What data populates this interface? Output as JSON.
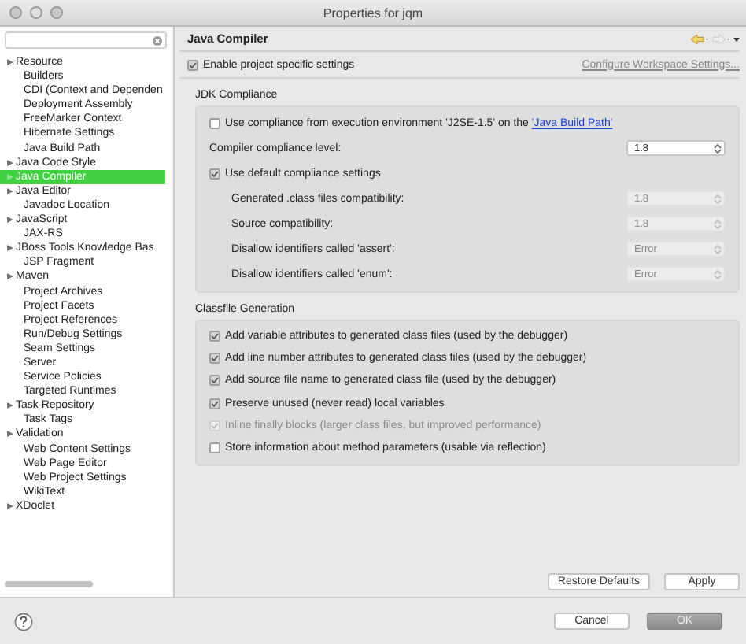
{
  "window": {
    "title": "Properties for jqm"
  },
  "sidebar": {
    "items": [
      {
        "label": "Resource",
        "kind": "group",
        "selected": false
      },
      {
        "label": "Builders",
        "kind": "page",
        "selected": false
      },
      {
        "label": "CDI (Context and Dependen",
        "kind": "page",
        "selected": false
      },
      {
        "label": "Deployment Assembly",
        "kind": "page",
        "selected": false
      },
      {
        "label": "FreeMarker Context",
        "kind": "page",
        "selected": false
      },
      {
        "label": "Hibernate Settings",
        "kind": "page",
        "selected": false
      },
      {
        "label": "Java Build Path",
        "kind": "page",
        "selected": false
      },
      {
        "label": "Java Code Style",
        "kind": "group",
        "selected": false
      },
      {
        "label": "Java Compiler",
        "kind": "group",
        "selected": true
      },
      {
        "label": "Java Editor",
        "kind": "group",
        "selected": false
      },
      {
        "label": "Javadoc Location",
        "kind": "page",
        "selected": false
      },
      {
        "label": "JavaScript",
        "kind": "group",
        "selected": false
      },
      {
        "label": "JAX-RS",
        "kind": "page",
        "selected": false
      },
      {
        "label": "JBoss Tools Knowledge Bas",
        "kind": "group",
        "selected": false
      },
      {
        "label": "JSP Fragment",
        "kind": "page",
        "selected": false
      },
      {
        "label": "Maven",
        "kind": "group",
        "selected": false
      },
      {
        "label": "Project Archives",
        "kind": "page",
        "selected": false
      },
      {
        "label": "Project Facets",
        "kind": "page",
        "selected": false
      },
      {
        "label": "Project References",
        "kind": "page",
        "selected": false
      },
      {
        "label": "Run/Debug Settings",
        "kind": "page",
        "selected": false
      },
      {
        "label": "Seam Settings",
        "kind": "page",
        "selected": false
      },
      {
        "label": "Server",
        "kind": "page",
        "selected": false
      },
      {
        "label": "Service Policies",
        "kind": "page",
        "selected": false
      },
      {
        "label": "Targeted Runtimes",
        "kind": "page",
        "selected": false
      },
      {
        "label": "Task Repository",
        "kind": "group",
        "selected": false
      },
      {
        "label": "Task Tags",
        "kind": "page",
        "selected": false
      },
      {
        "label": "Validation",
        "kind": "group",
        "selected": false
      },
      {
        "label": "Web Content Settings",
        "kind": "page",
        "selected": false
      },
      {
        "label": "Web Page Editor",
        "kind": "page",
        "selected": false
      },
      {
        "label": "Web Project Settings",
        "kind": "page",
        "selected": false
      },
      {
        "label": "WikiText",
        "kind": "page",
        "selected": false
      },
      {
        "label": "XDoclet",
        "kind": "group",
        "selected": false
      }
    ]
  },
  "page": {
    "title": "Java Compiler",
    "enable": {
      "label": "Enable project specific settings",
      "checked": true
    },
    "workspace_link": "Configure Workspace Settings...",
    "jdk_compliance": {
      "title": "JDK Compliance",
      "use_environment": {
        "label": "Use compliance from execution environment 'J2SE-1.5' on the ",
        "link": "'Java Build Path'",
        "checked": false
      },
      "compliance_level": {
        "label": "Compiler compliance level:",
        "value": "1.8",
        "disabled": false
      },
      "use_default": {
        "label": "Use default compliance settings",
        "checked": true
      },
      "settings": [
        {
          "label": "Generated .class files compatibility:",
          "value": "1.8",
          "disabled": true
        },
        {
          "label": "Source compatibility:",
          "value": "1.8",
          "disabled": true
        },
        {
          "label": "Disallow identifiers called 'assert':",
          "value": "Error",
          "disabled": true
        },
        {
          "label": "Disallow identifiers called 'enum':",
          "value": "Error",
          "disabled": true
        }
      ]
    },
    "classfile_generation": {
      "title": "Classfile Generation",
      "options": [
        {
          "label": "Add variable attributes to generated class files (used by the debugger)",
          "checked": true,
          "disabled": false
        },
        {
          "label": "Add line number attributes to generated class files (used by the debugger)",
          "checked": true,
          "disabled": false
        },
        {
          "label": "Add source file name to generated class file (used by the debugger)",
          "checked": true,
          "disabled": false
        },
        {
          "label": "Preserve unused (never read) local variables",
          "checked": true,
          "disabled": false
        },
        {
          "label": "Inline finally blocks (larger class files, but improved performance)",
          "checked": true,
          "disabled": true
        },
        {
          "label": "Store information about method parameters (usable via reflection)",
          "checked": false,
          "disabled": false
        }
      ]
    },
    "buttons": [
      "Restore Defaults",
      "Apply"
    ]
  },
  "footer": {
    "buttons": [
      {
        "label": "Cancel",
        "kind": "secondary"
      },
      {
        "label": "OK",
        "kind": "default"
      }
    ]
  }
}
